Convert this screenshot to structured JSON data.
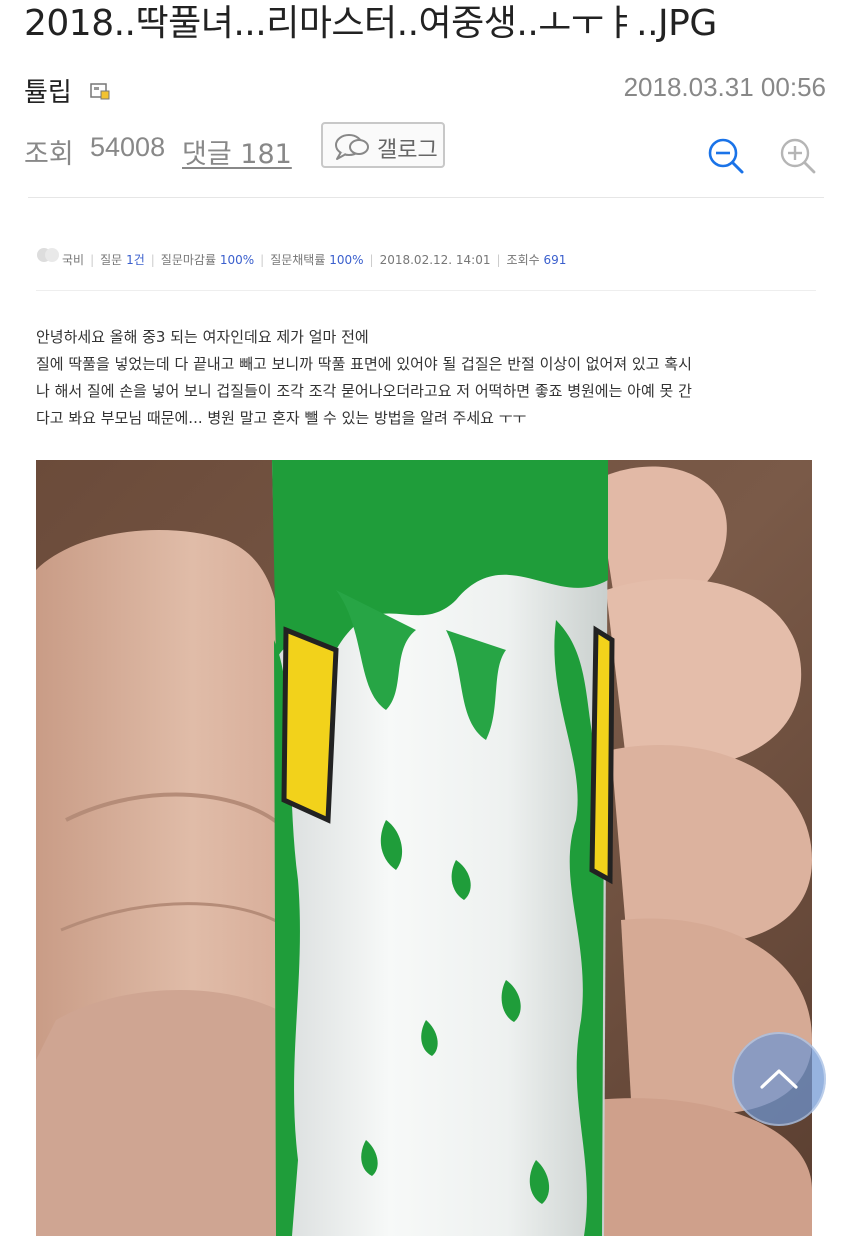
{
  "post": {
    "title": "2018..딱풀녀...리마스터..여중생..ㅗㅜㅑ..JPG",
    "author": "튤립",
    "date": "2018.03.31 00:56",
    "views_label": "조회",
    "views": "54008",
    "comments_label": "댓글 181",
    "gallog_label": "갤로그"
  },
  "question": {
    "asker": "국비",
    "items": [
      {
        "label": "질문",
        "value": "1건"
      },
      {
        "label": "질문마감률",
        "value": "100%"
      },
      {
        "label": "질문채택률",
        "value": "100%"
      }
    ],
    "date": "2018.02.12. 14:01",
    "views_label": "조회수",
    "views": "691",
    "body_lines": [
      "안녕하세요 올해 중3 되는 여자인데요 제가 얼마 전에",
      "질에 딱풀을 넣었는데 다 끝내고 빼고 보니까 딱풀 표면에 있어야 될 겁질은 반절 이상이 없어져 있고 혹시",
      "나 해서 질에 손을 넣어 보니 겁질들이 조각 조각 묻어나오더라고요 저 어떡하면 좋죠 병원에는 아예 못 간",
      "다고 봐요 부모님 때문에... 병원 말고 혼자 뺄 수 있는 방법을 알려 주세요 ㅜㅜ"
    ]
  },
  "icons": {
    "level": "gallery-level-icon",
    "gallog": "speech-bubble-icon",
    "zoom_out": "zoom-out-icon",
    "zoom_in": "zoom-in-icon",
    "scroll_top": "chevron-up-icon"
  },
  "colors": {
    "accent_blue": "#1a73e8",
    "link_blue": "#3a5fcd",
    "glue_green": "#1f9d3a"
  }
}
